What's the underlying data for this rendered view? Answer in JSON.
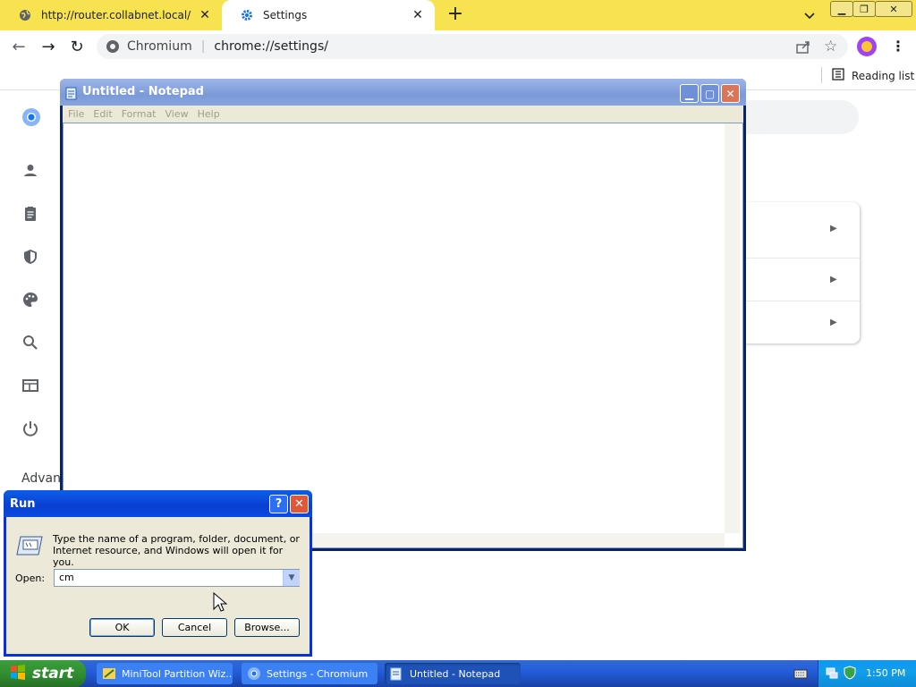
{
  "browser": {
    "tabs": [
      {
        "label": "http://router.collabnet.local/",
        "icon": "globe-icon",
        "active": false
      },
      {
        "label": "Settings",
        "icon": "gear-icon",
        "active": true
      }
    ],
    "address": {
      "site": "Chromium",
      "url": "chrome://settings/"
    },
    "reading_list": "Reading list",
    "settings_advanced": "Advanc"
  },
  "notepad": {
    "title": "Untitled - Notepad",
    "menu": [
      "File",
      "Edit",
      "Format",
      "View",
      "Help"
    ],
    "content": ""
  },
  "run_dialog": {
    "title": "Run",
    "description": "Type the name of a program, folder, document, or Internet resource, and Windows will open it for you.",
    "open_label": "Open:",
    "input_value": "cm",
    "ok": "OK",
    "cancel": "Cancel",
    "browse": "Browse..."
  },
  "taskbar": {
    "start": "start",
    "tasks": [
      {
        "label": "MiniTool Partition Wiz...",
        "icon": "minitool-icon"
      },
      {
        "label": "Settings - Chromium",
        "icon": "chromium-icon"
      },
      {
        "label": "Untitled - Notepad",
        "icon": "notepad-icon",
        "active": true
      }
    ],
    "clock": "1:50 PM"
  },
  "colors": {
    "tabstrip": "#f7e24f",
    "xp_blue": "#0a3ed2",
    "taskbar": "#245edb",
    "start_green": "#2f8a2f"
  }
}
